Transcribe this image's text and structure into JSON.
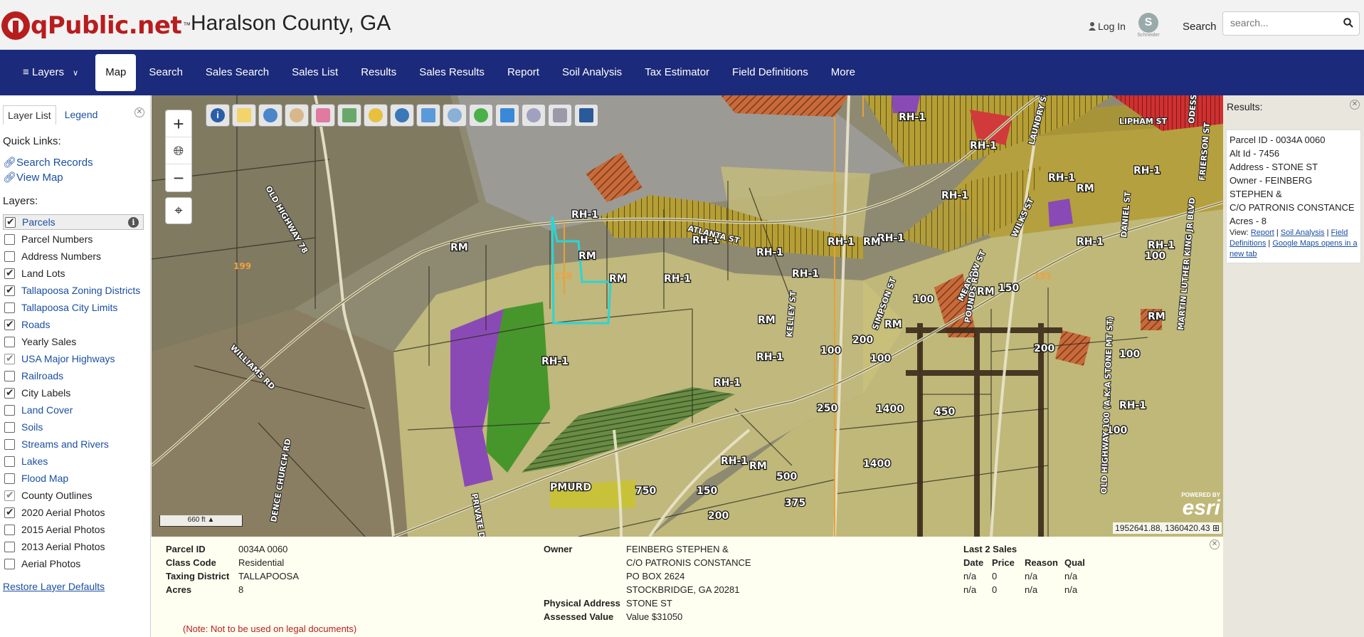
{
  "header": {
    "logo_text": "qPublic.net",
    "logo_tm": "™",
    "county": "Haralson County, GA",
    "login": "Log In",
    "schneider_label": "Schneider",
    "search_label": "Search",
    "search_placeholder": "search..."
  },
  "nav": {
    "layers": "Layers",
    "items": [
      "Map",
      "Search",
      "Sales Search",
      "Sales List",
      "Results",
      "Sales Results",
      "Report",
      "Soil Analysis",
      "Tax Estimator",
      "Field Definitions",
      "More"
    ]
  },
  "left": {
    "tab_layerlist": "Layer List",
    "tab_legend": "Legend",
    "quick_links_title": "Quick Links:",
    "link_search": "Search Records",
    "link_map": "View Map",
    "layers_title": "Layers:",
    "layers": [
      {
        "name": "Parcels",
        "checked": true,
        "link": true
      },
      {
        "name": "Parcel Numbers",
        "checked": false,
        "link": false
      },
      {
        "name": "Address Numbers",
        "checked": false,
        "link": false
      },
      {
        "name": "Land Lots",
        "checked": true,
        "link": false
      },
      {
        "name": "Tallapoosa Zoning Districts",
        "checked": true,
        "link": true
      },
      {
        "name": "Tallapoosa City Limits",
        "checked": false,
        "link": true
      },
      {
        "name": "Roads",
        "checked": true,
        "link": true
      },
      {
        "name": "Yearly Sales",
        "checked": false,
        "link": false
      },
      {
        "name": "USA Major Highways",
        "checked": "gray",
        "link": true
      },
      {
        "name": "Railroads",
        "checked": false,
        "link": true
      },
      {
        "name": "City Labels",
        "checked": true,
        "link": false
      },
      {
        "name": "Land Cover",
        "checked": false,
        "link": true
      },
      {
        "name": "Soils",
        "checked": false,
        "link": true
      },
      {
        "name": "Streams and Rivers",
        "checked": false,
        "link": true
      },
      {
        "name": "Lakes",
        "checked": false,
        "link": true
      },
      {
        "name": "Flood Map",
        "checked": false,
        "link": true
      },
      {
        "name": "County Outlines",
        "checked": "gray",
        "link": false
      },
      {
        "name": "2020 Aerial Photos",
        "checked": true,
        "link": false
      },
      {
        "name": "2015 Aerial Photos",
        "checked": false,
        "link": false
      },
      {
        "name": "2013 Aerial Photos",
        "checked": false,
        "link": false
      },
      {
        "name": "Aerial Photos",
        "checked": false,
        "link": false
      }
    ],
    "restore": "Restore Layer Defaults"
  },
  "map": {
    "scale": "660 ft",
    "coords": "1952641.88, 1360420.43",
    "esri_powered": "POWERED BY",
    "esri": "esri",
    "labels": [
      {
        "t": "RH-1"
      },
      {
        "t": "RM"
      },
      {
        "t": "178"
      },
      {
        "t": "199"
      },
      {
        "t": "PMURD"
      },
      {
        "t": "750"
      },
      {
        "t": "150"
      },
      {
        "t": "200"
      },
      {
        "t": "375"
      },
      {
        "t": "500"
      },
      {
        "t": "1400"
      },
      {
        "t": "450"
      },
      {
        "t": "250"
      },
      {
        "t": "100"
      },
      {
        "t": "151"
      }
    ],
    "streets": [
      "ATLANTA ST",
      "WILLIAMS RD",
      "OLD HIGHWAY 78",
      "LIPHAM ST",
      "KELLEY ST",
      "SIMPSON ST",
      "MEADOW ST",
      "POUNDS RD",
      "DANIEL ST",
      "MARTIN LUTHER KING JR BLVD",
      "FRIERSON ST",
      "ODESSA",
      "PRIVATE DRIVEWAY",
      "DENCE CHURCH RD",
      "OLD HIGHWAY 100 (A.K.A STONE MT ST)",
      "WILKS ST",
      "LAUNDRY ST"
    ]
  },
  "results": {
    "title": "Results:",
    "parcel_id": "Parcel ID - 0034A 0060",
    "alt_id": "Alt Id - 7456",
    "address": "Address - STONE ST",
    "owner": "Owner - FEINBERG STEPHEN &",
    "owner2": "C/O PATRONIS CONSTANCE",
    "acres": "Acres - 8",
    "view": "View:",
    "link_report": "Report",
    "link_soil": "Soil Analysis",
    "link_fields": "Field Definitions",
    "link_google": "Google Maps opens in a new tab"
  },
  "info": {
    "parcel_id_label": "Parcel ID",
    "parcel_id": "0034A 0060",
    "class_code_label": "Class Code",
    "class_code": "Residential",
    "taxing_label": "Taxing District",
    "taxing": "TALLAPOOSA",
    "acres_label": "Acres",
    "acres": "8",
    "owner_label": "Owner",
    "owner_lines": [
      "FEINBERG STEPHEN &",
      "C/O PATRONIS CONSTANCE",
      "PO BOX 2624",
      "STOCKBRIDGE, GA 20281"
    ],
    "physical_label": "Physical Address",
    "physical": "STONE ST",
    "assessed_label": "Assessed Value",
    "assessed": "Value $31050",
    "sales_title": "Last 2 Sales",
    "sales_headers": [
      "Date",
      "Price",
      "Reason",
      "Qual"
    ],
    "sales_rows": [
      [
        "n/a",
        "0",
        "n/a",
        "n/a"
      ],
      [
        "n/a",
        "0",
        "n/a",
        "n/a"
      ]
    ],
    "note": "(Note: Not to be used on legal documents)"
  },
  "colors": {
    "nav": "#1b2a7a",
    "brand": "#b81d1d",
    "zoning_yellow": "#c9b53a",
    "parcel_highlight": "#29d6d6"
  }
}
